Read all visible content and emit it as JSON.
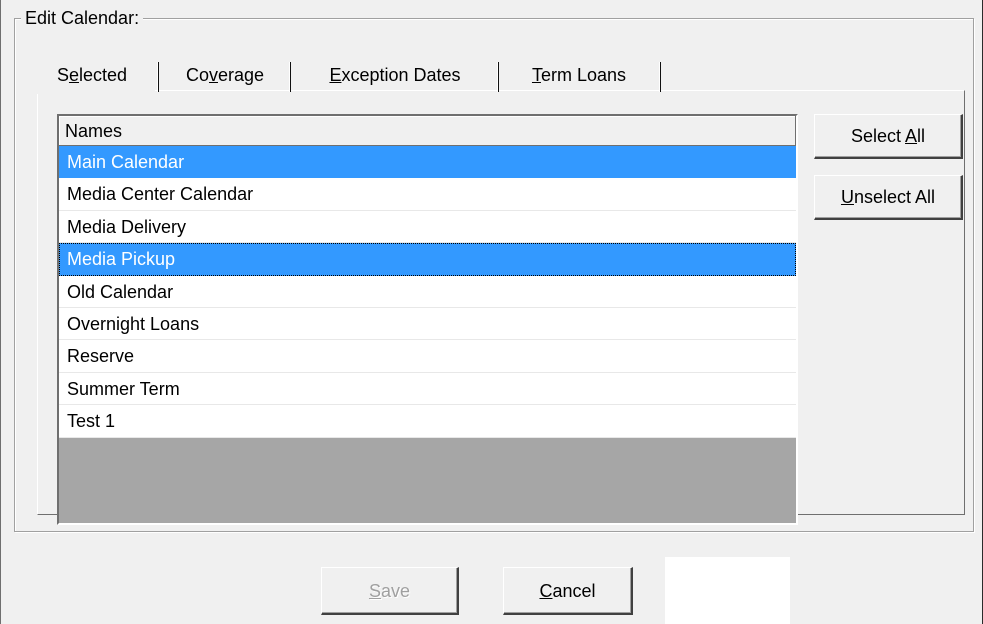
{
  "group": {
    "title": "Edit Calendar:"
  },
  "tabs": [
    {
      "label": "Selected",
      "mnemonic_index": 1
    },
    {
      "label": "Coverage",
      "mnemonic_index": 2
    },
    {
      "label": "Exception Dates",
      "mnemonic_index": 0
    },
    {
      "label": "Term Loans",
      "mnemonic_index": 0
    }
  ],
  "list": {
    "header": "Names",
    "rows": [
      {
        "name": "Main Calendar",
        "selected": true
      },
      {
        "name": "Media Center Calendar",
        "selected": false
      },
      {
        "name": "Media Delivery",
        "selected": false
      },
      {
        "name": "Media Pickup",
        "selected": true
      },
      {
        "name": "Old Calendar",
        "selected": false
      },
      {
        "name": "Overnight Loans",
        "selected": false
      },
      {
        "name": "Reserve",
        "selected": false
      },
      {
        "name": "Summer Term",
        "selected": false
      },
      {
        "name": "Test 1",
        "selected": false
      }
    ]
  },
  "buttons": {
    "select_all_pre": "Select ",
    "select_all_key": "A",
    "select_all_post": "ll",
    "unselect_all_key": "U",
    "unselect_all_post": "nselect All",
    "save_key": "S",
    "save_post": "ave",
    "cancel_key": "C",
    "cancel_post": "ancel"
  },
  "colors": {
    "selection": "#3399ff",
    "window": "#f0f0f0",
    "list_empty": "#a6a6a6"
  }
}
